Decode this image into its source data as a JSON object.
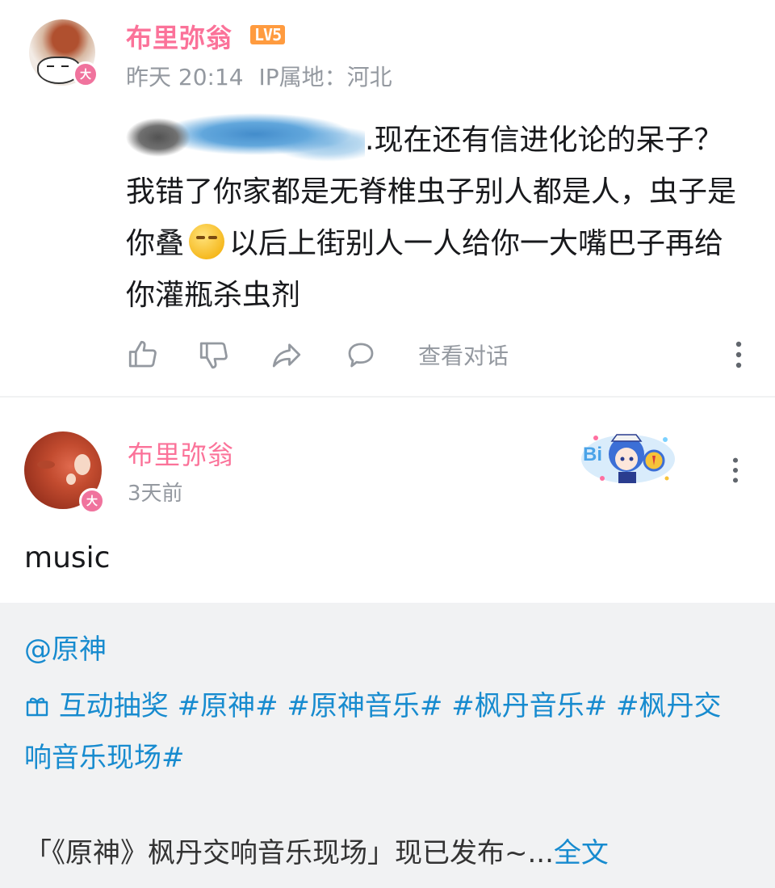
{
  "comment": {
    "username": "布里弥翁",
    "level": "LV5",
    "avatar_badge": "大",
    "time": "昨天 20:14",
    "ip_location": "IP属地：河北",
    "text_line1_after_redaction": ".现在还有信进化论的呆",
    "text_rest": "子？我错了你家都是无脊椎虫子别人都是人，虫子是你叠",
    "text_after_emoji": "以后上街别人一人给你一大嘴巴子再给你灌瓶杀虫剂",
    "view_conversation": "查看对话"
  },
  "post": {
    "username": "布里弥翁",
    "avatar_badge": "大",
    "time": "3天前",
    "text": "music",
    "forward": {
      "mention": "@原神",
      "lottery_label": "互动抽奖",
      "hashtags": [
        "#原神#",
        "#原神音乐#",
        "#枫丹音乐#",
        "#枫丹交响音乐现场#"
      ],
      "desc": "「《原神》枫丹交响音乐现场」现已发布~...",
      "full_text_link": "全文"
    }
  },
  "colors": {
    "username_pink": "#fb7299",
    "level_orange": "#ff9b3f",
    "link_blue": "#178bcf",
    "meta_gray": "#9499a0",
    "card_bg": "#f1f2f3"
  }
}
